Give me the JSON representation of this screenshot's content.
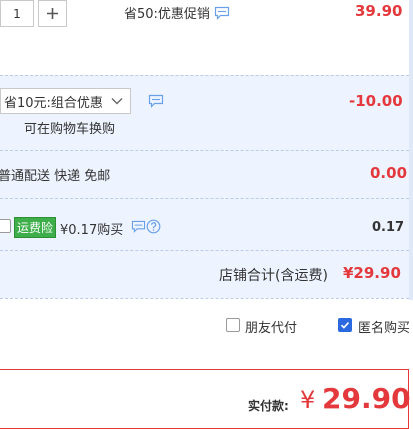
{
  "item": {
    "quantity": "1",
    "plus_label": "+",
    "promo_text": "省50:优惠促销",
    "price": "39.90"
  },
  "combo": {
    "selected": "省10元:组合优惠",
    "change_link": "可在购物车换购",
    "discount": "-10.00"
  },
  "shipping": {
    "label": "普通配送 快递 免邮",
    "cost": "0.00"
  },
  "insurance": {
    "badge": "运费险",
    "price_text": "¥0.17购买",
    "amount": "0.17"
  },
  "store_total": {
    "label": "店铺合计(含运费)",
    "amount": "¥29.90"
  },
  "options": {
    "friend_pay": "朋友代付",
    "anonymous": "匿名购买"
  },
  "payment": {
    "label": "实付款:",
    "currency": "¥",
    "amount": "29.90"
  },
  "colors": {
    "accent_red": "#e4393c",
    "band_blue": "#eef4ff",
    "checkbox_blue": "#2a69e0",
    "badge_green": "#3dae4a",
    "icon_blue": "#6aa0e8"
  },
  "icons": [
    "plus-icon",
    "chat-bubble-icon",
    "chevron-down-icon",
    "question-icon",
    "check-icon"
  ]
}
